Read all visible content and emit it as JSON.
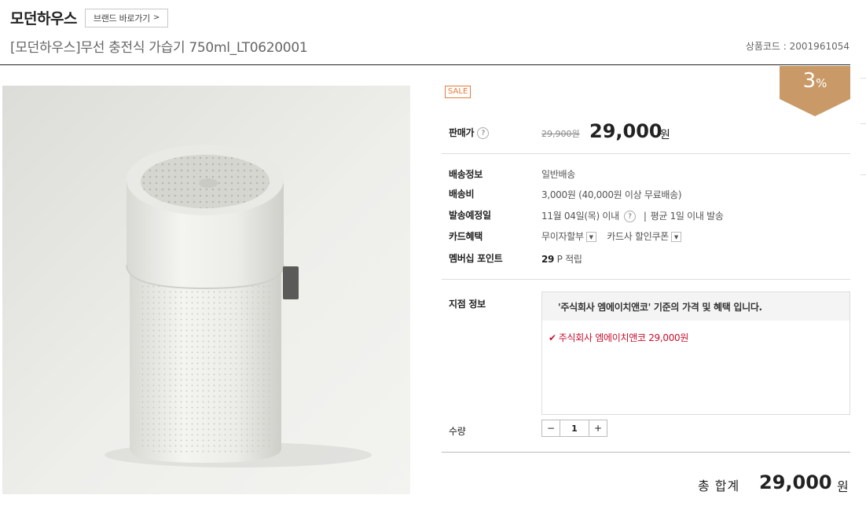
{
  "header": {
    "brand_name": "모던하우스",
    "brand_button": "브랜드 바로가기",
    "brand_button_chevron": ">",
    "product_title": "[모던하우스]무선 충전식 가습기 750ml_LT0620001",
    "product_code": "상품코드 : 2001961054"
  },
  "badges": {
    "sale": "SALE",
    "discount_number": "3",
    "discount_unit": "%",
    "discount_color": "#c99a67"
  },
  "price": {
    "label": "판매가",
    "original": "29,900원",
    "current": "29,000",
    "unit": "원"
  },
  "info": {
    "shipping_label": "배송정보",
    "shipping_value": "일반배송",
    "fee_label": "배송비",
    "fee_value": "3,000원 (40,000원 이상 무료배송)",
    "schedule_label": "발송예정일",
    "schedule_date": "11월 04일(목) 이내",
    "schedule_avg": "평균 1일 이내 발송",
    "card_label": "카드혜택",
    "card_option1": "무이자할부",
    "card_option2": "카드사 할인쿠폰",
    "points_label": "멤버십 포인트",
    "points_number": "29",
    "points_suffix": "P 적립"
  },
  "branch": {
    "label": "지점 정보",
    "header": "'주식회사 엠에이치앤코' 기준의 가격 및 혜택 입니다.",
    "item": "주식회사 엠에이치앤코 29,000원"
  },
  "quantity": {
    "label": "수량",
    "minus": "−",
    "value": "1",
    "plus": "+"
  },
  "total": {
    "label": "총 합계",
    "price": "29,000",
    "unit": "원"
  },
  "icons": {
    "help": "?",
    "dropdown": "▼",
    "check": "✔"
  }
}
